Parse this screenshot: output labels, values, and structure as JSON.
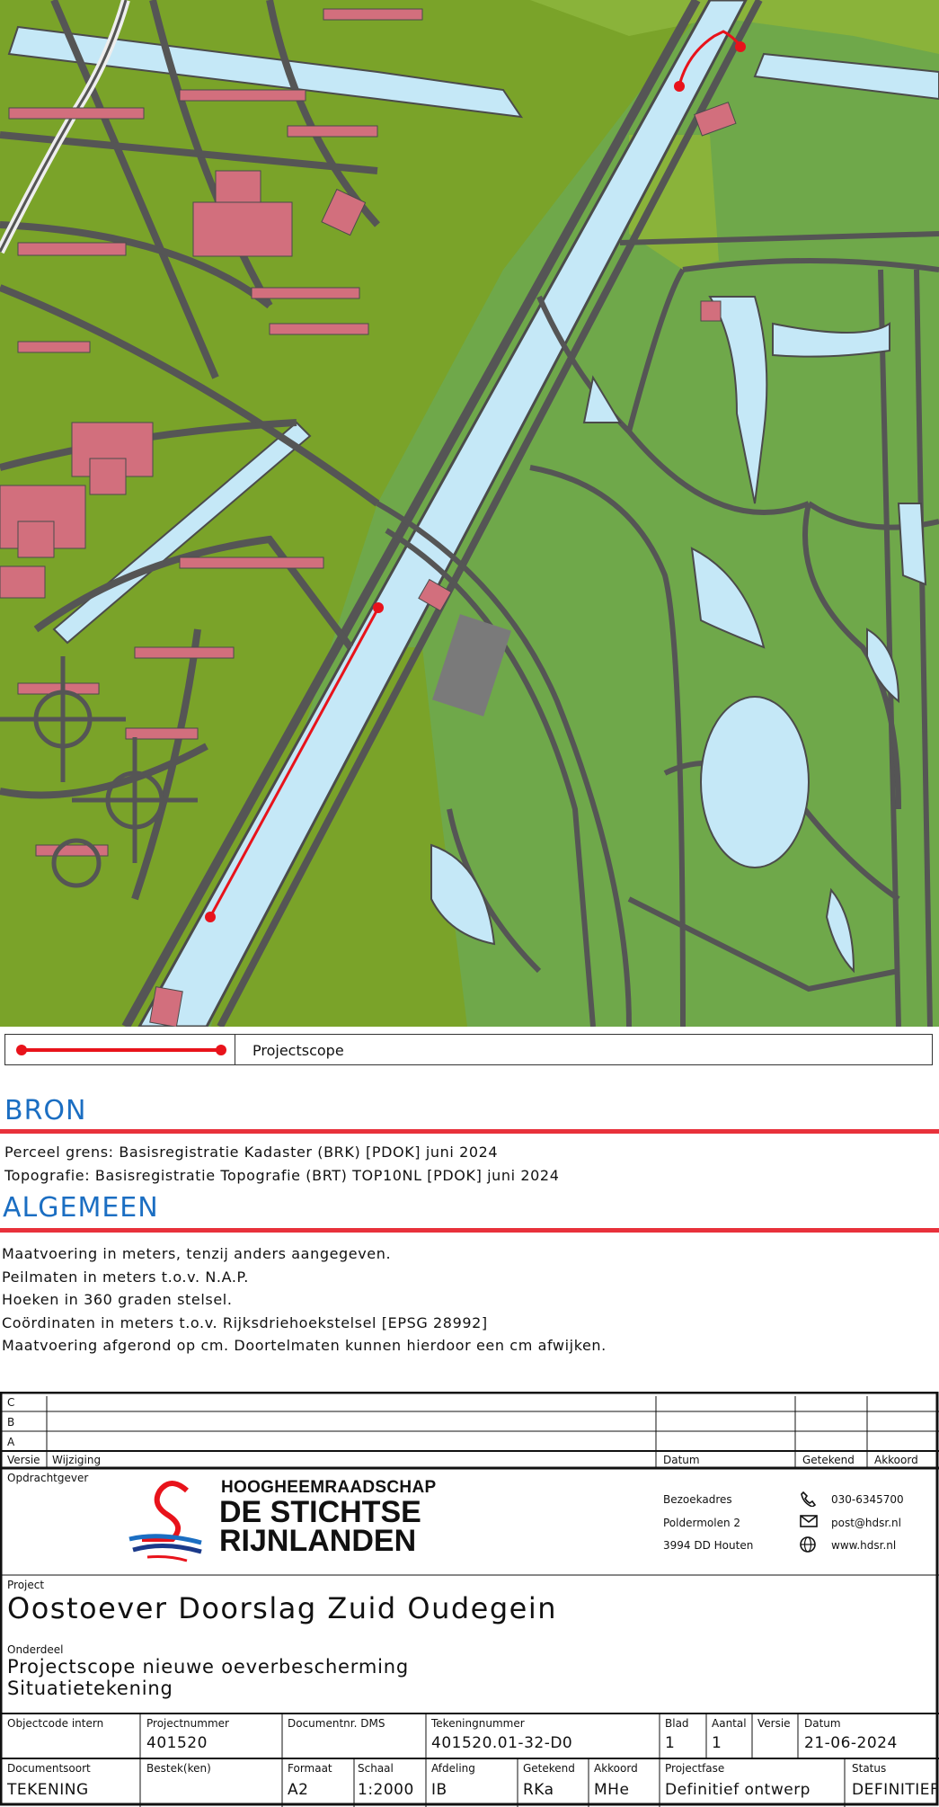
{
  "legend": {
    "projectscope_label": "Projectscope",
    "route_color": "#e8131b"
  },
  "bron": {
    "title": "BRON",
    "lines": [
      "Perceel grens: Basisregistratie Kadaster (BRK) [PDOK] juni 2024",
      "Topografie: Basisregistratie Topografie (BRT) TOP10NL [PDOK] juni 2024"
    ]
  },
  "algemeen": {
    "title": "ALGEMEEN",
    "lines": [
      "Maatvoering in meters, tenzij anders aangegeven.",
      "Peilmaten in meters t.o.v. N.A.P.",
      "Hoeken in 360 graden stelsel.",
      "Coördinaten in meters t.o.v. Rijksdriehoekstelsel [EPSG 28992]",
      "Maatvoering afgerond op cm. Doortelmaten kunnen hierdoor een cm afwijken."
    ]
  },
  "revisions": {
    "rows": [
      "C",
      "B",
      "A"
    ],
    "headers": {
      "versie": "Versie",
      "wijziging": "Wijziging",
      "datum": "Datum",
      "getekend": "Getekend",
      "akkoord": "Akkoord"
    }
  },
  "client": {
    "label": "Opdrachtgever",
    "logo_line1": "HOOGHEEMRAADSCHAP",
    "logo_line2": "DE STICHTSE",
    "logo_line3": "RIJNLANDEN",
    "address_label": "Bezoekadres",
    "street": "Poldermolen 2",
    "city": "3994 DD Houten",
    "phone": "030-6345700",
    "email": "post@hdsr.nl",
    "web": "www.hdsr.nl"
  },
  "project": {
    "label": "Project",
    "name": "Oostoever Doorslag Zuid Oudegein",
    "onderdeel_label": "Onderdeel",
    "onderdeel_line1": "Projectscope nieuwe oeverbescherming",
    "onderdeel_line2": "Situatietekening"
  },
  "meta": {
    "objectcode_label": "Objectcode intern",
    "objectcode": "",
    "projectnummer_label": "Projectnummer",
    "projectnummer": "401520",
    "documentnr_label": "Documentnr. DMS",
    "documentnr": "",
    "tekeningnummer_label": "Tekeningnummer",
    "tekeningnummer": "401520.01-32-D0",
    "blad_label": "Blad",
    "blad": "1",
    "aantal_label": "Aantal",
    "aantal": "1",
    "versie_label": "Versie",
    "versie": "",
    "datum_label": "Datum",
    "datum": "21-06-2024",
    "documentsoort_label": "Documentsoort",
    "documentsoort": "TEKENING",
    "bestek_label": "Bestek(ken)",
    "bestek": "",
    "formaat_label": "Formaat",
    "formaat": "A2",
    "schaal_label": "Schaal",
    "schaal": "1:2000",
    "afdeling_label": "Afdeling",
    "afdeling": "IB",
    "getekend_label": "Getekend",
    "getekend": "RKa",
    "akkoord_label": "Akkoord",
    "akkoord": "MHe",
    "projectfase_label": "Projectfase",
    "projectfase": "Definitief ontwerp",
    "status_label": "Status",
    "status": "DEFINITIEF"
  },
  "colors": {
    "grass": "#7aa329",
    "park": "#6fa84a",
    "road": "#5d5d5d",
    "water": "#c5e8f7",
    "building": "#d26f7d",
    "accent_blue": "#1b6ec2",
    "accent_red": "#e8313b"
  }
}
